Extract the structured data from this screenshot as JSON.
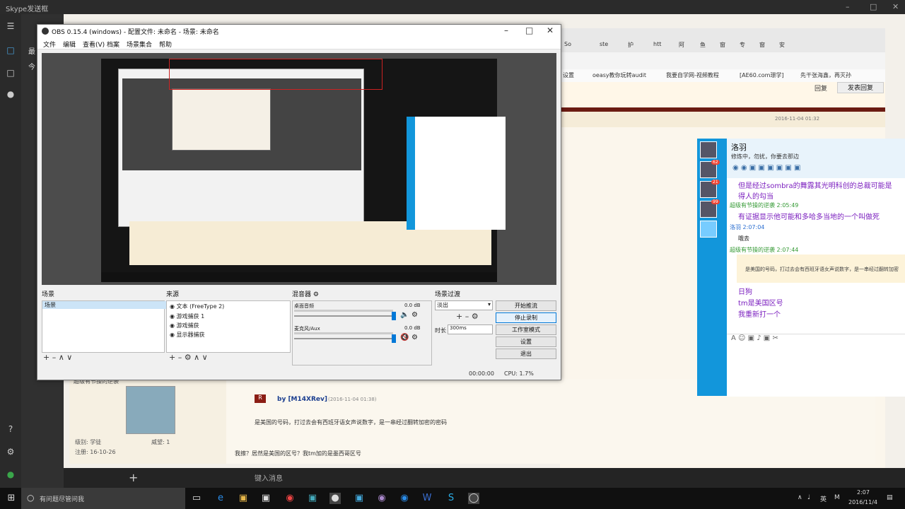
{
  "skype": {
    "title": "Skype发送框",
    "side_labels": [
      "最",
      "今"
    ],
    "input_placeholder": "键入消息"
  },
  "chrome": {
    "tabs": [
      "So",
      "ste",
      "护",
      "htt",
      "阿",
      "鱼",
      "窗",
      "专",
      "窗",
      "安"
    ],
    "bookmarks": [
      "设置",
      "oeasy教你玩转audit",
      "我要自学网-视频教程",
      "[AE60.com璟学]",
      "先干张海鑫，再灭孙"
    ],
    "reply_buttons": [
      "回复",
      "发表回复"
    ],
    "post_date_top": "2016-11-04 01:32"
  },
  "forum_post": {
    "author_header": "超级有节操的逆袭",
    "by_line": "by [M14XRev]",
    "date": "(2016-11-04 01:38)",
    "quote": "是美国的号码，打过去会有西班牙语女声说数字，是一串经过翻转加密的密码",
    "reply": "我擦？居然是美国的区号？我tm加的是墨西哥区号",
    "level": "级别: 学徒",
    "prestige": "威望: 1",
    "registered": "注册: 16-10-26"
  },
  "obs": {
    "title": "OBS 0.15.4 (windows) - 配置文件: 未命名 - 场景: 未命名",
    "menu": [
      "文件",
      "编辑",
      "查看(V)",
      "档案",
      "场景集合",
      "帮助"
    ],
    "scenes_label": "场景",
    "scenes": [
      "场景"
    ],
    "sources_label": "来源",
    "sources": [
      "文本 (FreeType 2)",
      "游戏捕获 1",
      "游戏捕获",
      "显示器捕获"
    ],
    "mixer_label": "混音器",
    "mixer": [
      {
        "name": "桌面音频",
        "db": "0.0 dB"
      },
      {
        "name": "麦克风/Aux",
        "db": "0.0 dB"
      }
    ],
    "transitions_label": "场景过渡",
    "transition_value": "淡出",
    "duration_label": "时长",
    "duration_value": "300ms",
    "buttons": [
      "开始推流",
      "停止录制",
      "工作室模式",
      "设置",
      "退出"
    ],
    "status_time": "00:00:00",
    "status_cpu": "CPU: 1.7%"
  },
  "qq": {
    "contact": "洛羽",
    "status": "修炼中，勿扰，你要去那边",
    "badges": [
      "62",
      "21",
      "99"
    ],
    "messages": [
      {
        "type": "text",
        "text": "但是经过sombra的舞露其光明科创的总裁可能是"
      },
      {
        "type": "text",
        "text": "得人的勾当"
      },
      {
        "type": "meta",
        "text": "超级有节操的逆袭 2:05:49"
      },
      {
        "type": "text",
        "text": "有证据显示他可能和多哈多当地的一个叫做死"
      },
      {
        "type": "meta2",
        "text": "洛羽 2:07:04"
      },
      {
        "type": "plain",
        "text": "哦去"
      },
      {
        "type": "meta",
        "text": "超级有节操的逆袭 2:07:44"
      },
      {
        "type": "quote",
        "text": "是美国的号码，打过去会有西班牙语女声说数字，是一串经过翻转加密"
      },
      {
        "type": "text",
        "text": "日狗"
      },
      {
        "type": "text",
        "text": "tm是美国区号"
      },
      {
        "type": "text",
        "text": "我重新打一个"
      }
    ]
  },
  "taskbar": {
    "search_placeholder": "有问题尽管问我",
    "tray_lang": "英",
    "tray_ime": "M",
    "time": "2:07",
    "date": "2016/11/4"
  },
  "colors": {
    "obs_bg": "#f0f0f0",
    "qq_blue": "#1296db",
    "qq_text": "#7b1fbf",
    "forum_red": "#6b1b12"
  }
}
